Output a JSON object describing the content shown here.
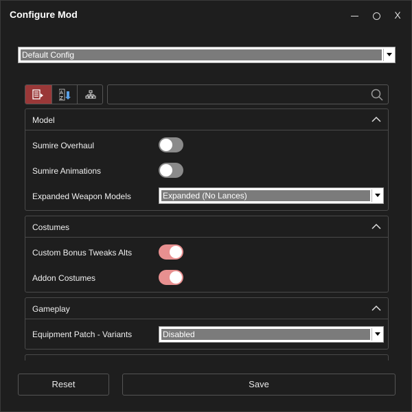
{
  "window": {
    "title": "Configure Mod",
    "controls": [
      "minimize-icon",
      "maximize-icon",
      "close-icon"
    ],
    "close_glyph": "X"
  },
  "config": {
    "selected": "Default Config"
  },
  "toolbar": {
    "views": [
      "list-view-icon",
      "sort-az-icon",
      "tree-view-icon"
    ],
    "active_view": "list-view-icon",
    "search_placeholder": ""
  },
  "sections": {
    "model": {
      "title": "Model",
      "sumire_overhaul": {
        "label": "Sumire Overhaul",
        "on": false
      },
      "sumire_animations": {
        "label": "Sumire Animations",
        "on": false
      },
      "expanded_weapons": {
        "label": "Expanded Weapon Models",
        "value": "Expanded (No Lances)"
      }
    },
    "costumes": {
      "title": "Costumes",
      "custom_bonus": {
        "label": "Custom Bonus Tweaks Alts",
        "on": true
      },
      "addon_costumes": {
        "label": "Addon Costumes",
        "on": true
      }
    },
    "gameplay": {
      "title": "Gameplay",
      "equipment_patch": {
        "label": "Equipment Patch - Variants",
        "value": "Disabled"
      }
    }
  },
  "footer": {
    "reset": "Reset",
    "save": "Save"
  },
  "colors": {
    "accent": "#9a3838",
    "toggle_on": "#e89090",
    "toggle_off": "#8a8a8a",
    "background": "#1e1e1e"
  }
}
